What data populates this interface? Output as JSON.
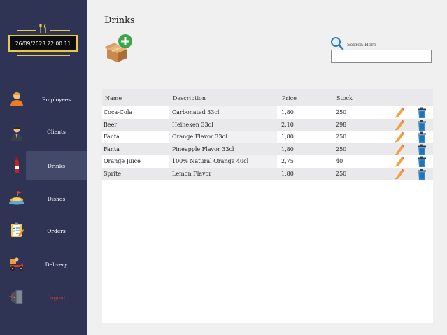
{
  "sidebar": {
    "datetime": "26/09/2023 22:00:11",
    "items": [
      {
        "label": "Employees",
        "icon": "employee-icon"
      },
      {
        "label": "Clients",
        "icon": "client-icon"
      },
      {
        "label": "Drinks",
        "icon": "bottle-icon"
      },
      {
        "label": "Dishes",
        "icon": "dish-icon"
      },
      {
        "label": "Orders",
        "icon": "clipboard-icon"
      },
      {
        "label": "Delivery",
        "icon": "delivery-icon"
      },
      {
        "label": "Logout",
        "icon": "door-icon"
      }
    ],
    "active": "Drinks",
    "accent": "#e6c84a",
    "background": "#2f3455",
    "logout_color": "#d43a36"
  },
  "page": {
    "title": "Drinks",
    "search_label": "Search Here",
    "search_value": ""
  },
  "table": {
    "headers": {
      "name": "Name",
      "description": "Description",
      "price": "Price",
      "stock": "Stock"
    },
    "rows": [
      {
        "name": "Coca-Cola",
        "description": "Carbonated 33cl",
        "price": "1,80",
        "stock": "250"
      },
      {
        "name": "Beer",
        "description": "Heineken 33cl",
        "price": "2,10",
        "stock": "298"
      },
      {
        "name": "Fanta",
        "description": "Orange Flavor 33cl",
        "price": "1,80",
        "stock": "250"
      },
      {
        "name": "Fanta",
        "description": "Pineapple Flavor 33cl",
        "price": "1,80",
        "stock": "250"
      },
      {
        "name": "Orange Juice",
        "description": "100% Natural Orange 40cl",
        "price": "2,75",
        "stock": "40"
      },
      {
        "name": "Sprite",
        "description": "Lemon Flavor",
        "price": "1,80",
        "stock": "250"
      }
    ]
  }
}
